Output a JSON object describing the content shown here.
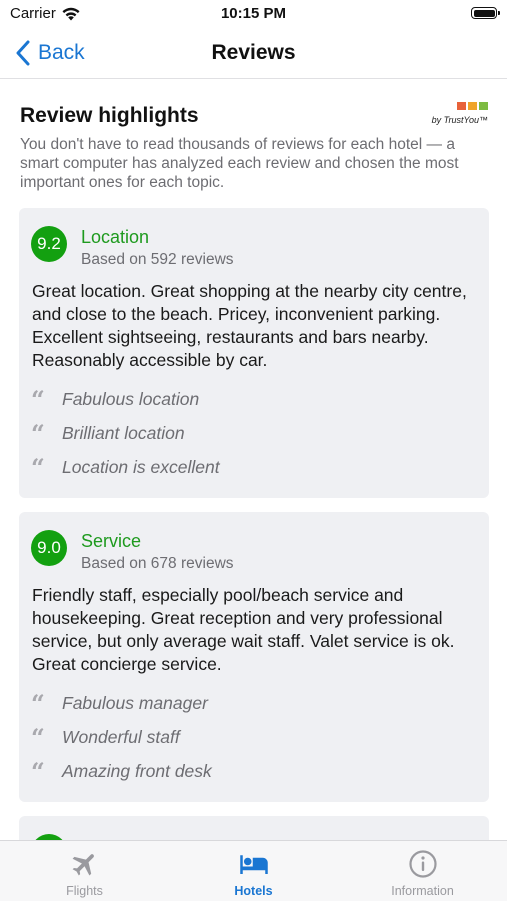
{
  "status_bar": {
    "carrier": "Carrier",
    "time": "10:15 PM"
  },
  "nav": {
    "back_label": "Back",
    "title": "Reviews"
  },
  "highlights": {
    "title": "Review highlights",
    "logo_text": "by TrustYou™",
    "intro": "You don't have to read thousands of reviews for each hotel — a smart computer has analyzed each review and chosen the most important ones for each topic."
  },
  "cards": [
    {
      "score": "9.2",
      "topic": "Location",
      "based_on": "Based on 592 reviews",
      "summary": "Great location. Great shopping at the nearby city centre, and close to the beach. Pricey, inconvenient parking. Excellent sightseeing, restaurants and bars nearby. Reasonably accessible by car.",
      "quotes": [
        "Fabulous location",
        "Brilliant location",
        "Location is excellent"
      ]
    },
    {
      "score": "9.0",
      "topic": "Service",
      "based_on": "Based on 678 reviews",
      "summary": "Friendly staff, especially pool/beach service and housekeeping. Great reception and very professional service, but only average wait staff. Valet service is ok. Great concierge service.",
      "quotes": [
        "Fabulous manager",
        "Wonderful staff",
        "Amazing front desk"
      ]
    }
  ],
  "tabs": [
    {
      "label": "Flights",
      "icon": "airplane-icon",
      "active": false
    },
    {
      "label": "Hotels",
      "icon": "bed-icon",
      "active": true
    },
    {
      "label": "Information",
      "icon": "info-icon",
      "active": false
    }
  ],
  "colors": {
    "accent": "#1a76d2",
    "score_green": "#13a010",
    "topic_green": "#1e9a1e",
    "card_bg": "#eff0f3"
  }
}
